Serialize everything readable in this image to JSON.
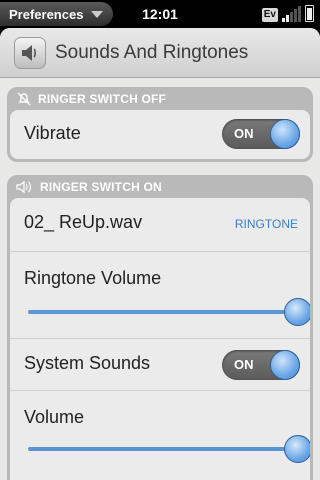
{
  "status_bar": {
    "app_menu_label": "Preferences",
    "clock": "12:01",
    "network_badge": "Ev",
    "signal_bars_on": 2,
    "signal_bars_total": 5
  },
  "header": {
    "title": "Sounds And Ringtones",
    "icon": "speaker-icon"
  },
  "ringer_off": {
    "label": "RINGER SWITCH OFF",
    "icon": "muted-bell-icon",
    "vibrate": {
      "label": "Vibrate",
      "toggle": "ON"
    }
  },
  "ringer_on": {
    "label": "RINGER SWITCH ON",
    "icon": "speaker-sound-icon",
    "ringtone": {
      "name": "02_ ReUp.wav",
      "type": "RINGTONE"
    },
    "ringtone_volume": {
      "label": "Ringtone Volume",
      "level": 1.0
    },
    "system_sounds": {
      "label": "System Sounds",
      "toggle": "ON"
    },
    "volume": {
      "label": "Volume",
      "level": 1.0
    }
  },
  "colors": {
    "accent": "#5b95d4",
    "link": "#3b7fc4"
  }
}
